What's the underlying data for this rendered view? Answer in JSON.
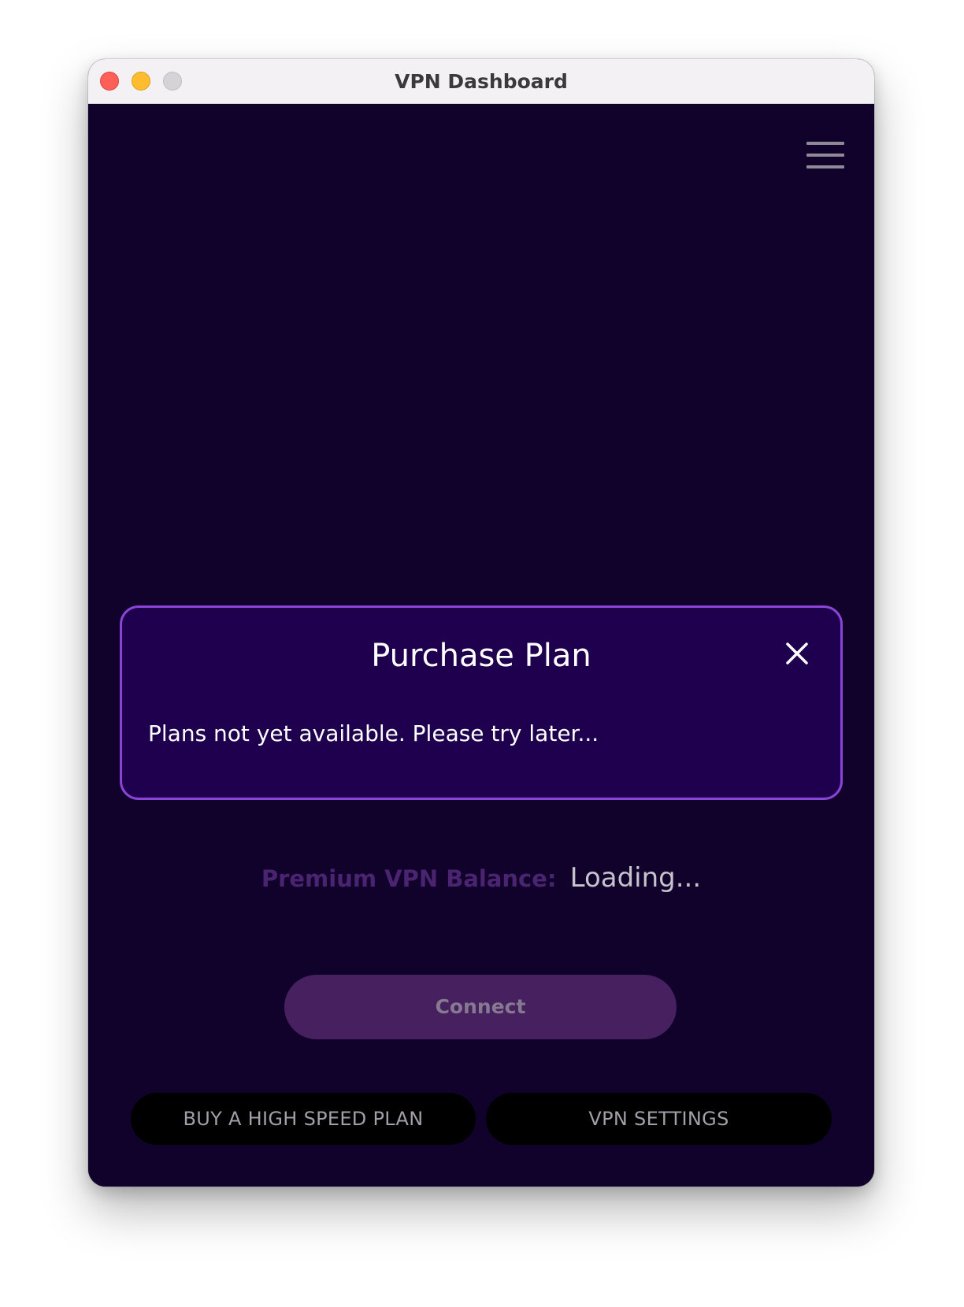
{
  "window": {
    "title": "VPN Dashboard"
  },
  "header": {
    "menu_icon": "hamburger-menu-icon"
  },
  "modal": {
    "title": "Purchase Plan",
    "message": "Plans not yet available. Please try later...",
    "close_icon": "close-icon"
  },
  "balance": {
    "label": "Premium VPN Balance:",
    "value": "Loading..."
  },
  "actions": {
    "connect_label": "Connect",
    "buy_plan_label": "BUY A HIGH SPEED PLAN",
    "settings_label": "VPN SETTINGS"
  },
  "colors": {
    "background": "#10022b",
    "modal_background": "#1e004e",
    "modal_border": "#8a45d6",
    "connect_button": "#46205f",
    "balance_label": "#4a2470"
  }
}
